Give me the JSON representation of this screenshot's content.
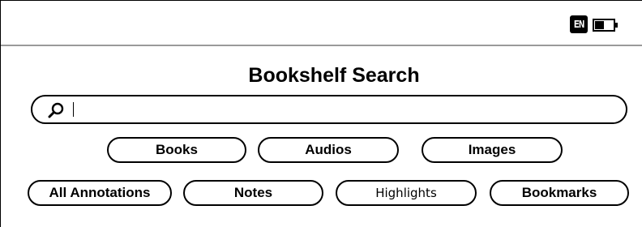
{
  "status_bar": {
    "language": "EN",
    "battery_icon": "battery-icon"
  },
  "title": "Bookshelf Search",
  "search": {
    "icon": "search-icon",
    "value": "",
    "placeholder": ""
  },
  "media_filters": [
    {
      "label": "Books"
    },
    {
      "label": "Audios"
    },
    {
      "label": "Images"
    }
  ],
  "annotation_filters": [
    {
      "label": "All Annotations"
    },
    {
      "label": "Notes"
    },
    {
      "label": "Highlights",
      "selected": true
    },
    {
      "label": "Bookmarks"
    }
  ]
}
